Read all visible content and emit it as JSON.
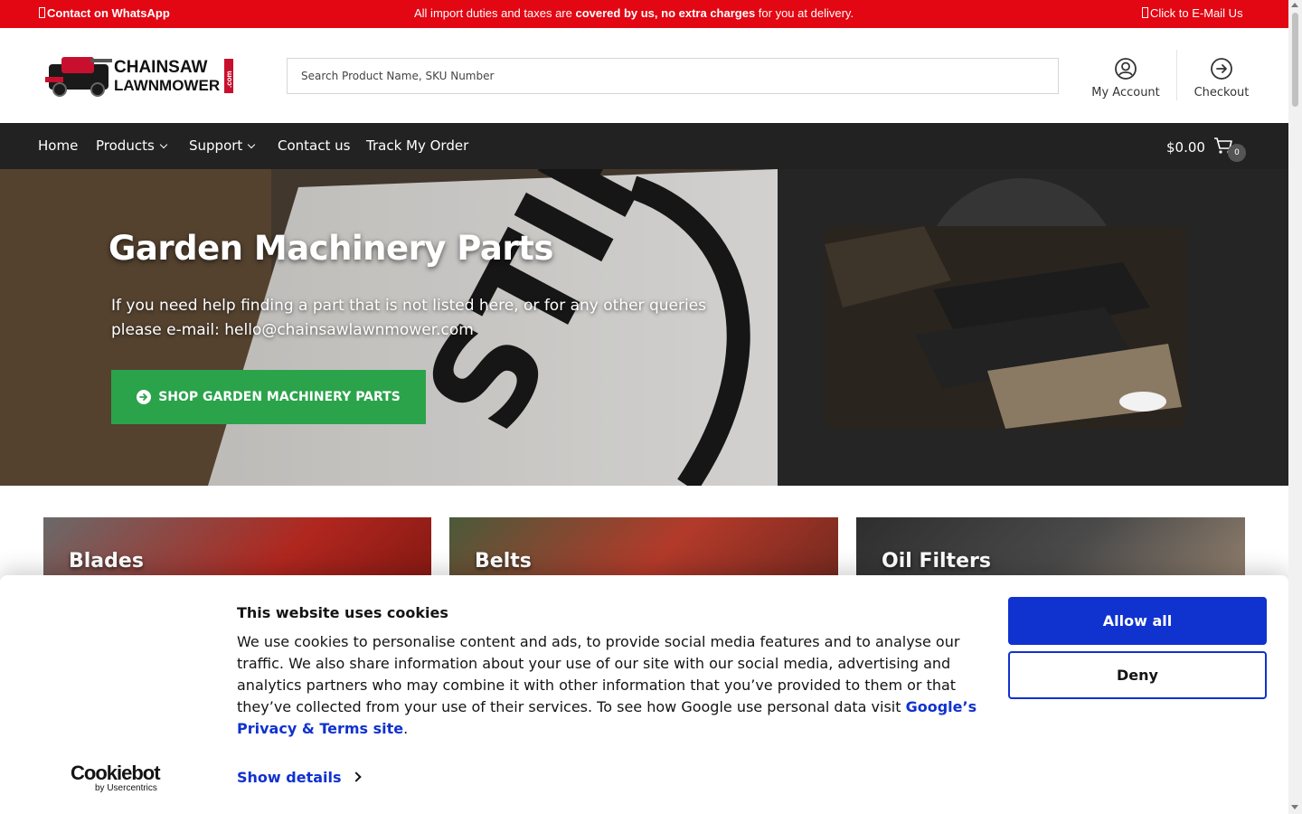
{
  "topbar": {
    "whatsapp_label": "Contact on WhatsApp",
    "notice_part1": "All import duties and taxes are ",
    "notice_bold": "covered by us, no extra charges",
    "notice_part2": " for you at delivery.",
    "email_label": "Click to E-Mail Us"
  },
  "header": {
    "logo_line1": "CHAINSAW",
    "logo_line2": "LAWNMOWER",
    "logo_suffix": ".com",
    "search_placeholder": "Search Product Name, SKU Number",
    "account_label": "My Account",
    "checkout_label": "Checkout"
  },
  "nav": {
    "items": [
      {
        "label": "Home"
      },
      {
        "label": "Products"
      },
      {
        "label": "Support"
      },
      {
        "label": "Contact us"
      },
      {
        "label": "Track My Order"
      }
    ],
    "cart_total": "$0.00",
    "cart_count": "0"
  },
  "hero": {
    "title": "Garden Machinery Parts",
    "text": "If you need help finding a part that is not listed here, or for any other queries please e-mail: hello@chainsawlawnmower.com",
    "button_label": "SHOP GARDEN MACHINERY PARTS",
    "brand_watermark": "STIHL"
  },
  "categories": [
    {
      "label": "Blades"
    },
    {
      "label": "Belts"
    },
    {
      "label": "Oil Filters"
    }
  ],
  "cookie": {
    "title": "This website uses cookies",
    "body": "We use cookies to personalise content and ads, to provide social media features and to analyse our traffic. We also share information about your use of our site with our social media, advertising and analytics partners who may combine it with other information that you’ve provided to them or that they’ve collected from your use of their services. To see how Google use personal data visit ",
    "link_label": "Google’s Privacy & Terms site",
    "body_end": ".",
    "details_label": "Show details",
    "allow_label": "Allow all",
    "deny_label": "Deny",
    "brand_main": "Cookiebot",
    "brand_sub": "by Usercentrics"
  },
  "colors": {
    "topbar_red": "#e30613",
    "nav_dark": "#222222",
    "cta_green": "#2aa34a",
    "cookie_blue": "#1032cf"
  }
}
